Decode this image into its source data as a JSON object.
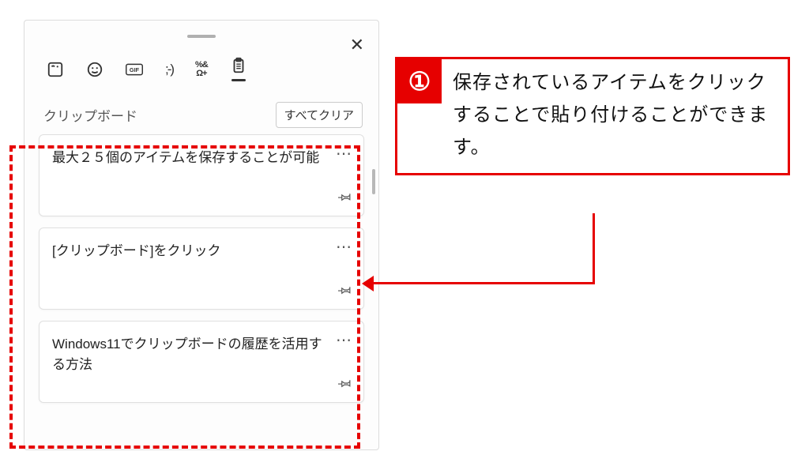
{
  "annotation": {
    "step_number": "①",
    "text": "保存されているアイテムをクリックすることで貼り付けることができます。",
    "color": "#e60000"
  },
  "panel": {
    "close_label": "✕",
    "toolbar": {
      "sticker": "sticker-icon",
      "emoji": "emoji-icon",
      "gif": "GIF",
      "kaomoji": ";-)",
      "symbols_top": "%&",
      "symbols_bottom": "Ω+",
      "clipboard": "clipboard-icon",
      "active": "clipboard"
    },
    "section_title": "クリップボード",
    "clear_all": "すべてクリア",
    "items": [
      {
        "text": "最大２５個のアイテムを保存することが可能"
      },
      {
        "text": "[クリップボード]をクリック"
      },
      {
        "text": "Windows11でクリップボードの履歴を活用する方法"
      }
    ],
    "more_label": "⋯"
  }
}
